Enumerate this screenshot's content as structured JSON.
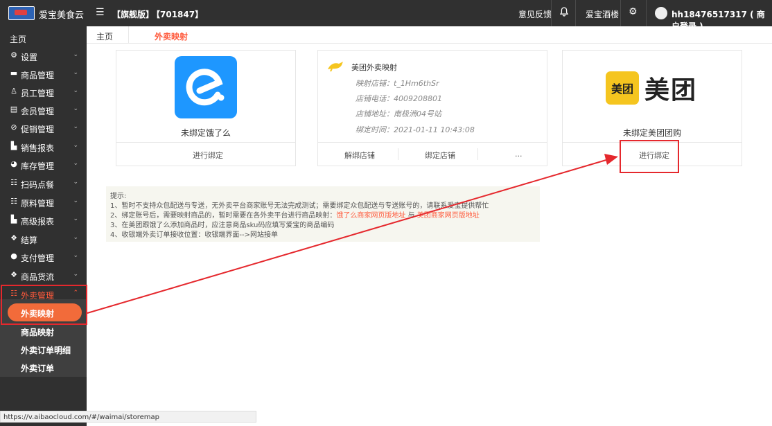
{
  "topbar": {
    "brand": "爱宝美食云",
    "menu_icon": "menu-icon",
    "edition": "【旗舰版】",
    "shop_id": "【701847】",
    "feedback": "意见反馈",
    "bell_icon": "bell-icon",
    "shop_name": "爱宝酒楼",
    "settings_icon": "gear-icon",
    "user": "hh18476517317 ( 商户登录 )"
  },
  "sidebar": {
    "home": "主页",
    "items": [
      {
        "label": "设置",
        "icon": "gear-icon"
      },
      {
        "label": "商品管理",
        "icon": "product-icon"
      },
      {
        "label": "员工管理",
        "icon": "staff-icon"
      },
      {
        "label": "会员管理",
        "icon": "member-icon"
      },
      {
        "label": "促销管理",
        "icon": "promo-icon"
      },
      {
        "label": "销售报表",
        "icon": "chart-icon"
      },
      {
        "label": "库存管理",
        "icon": "stock-icon"
      },
      {
        "label": "扫码点餐",
        "icon": "scan-icon"
      },
      {
        "label": "原料管理",
        "icon": "material-icon"
      },
      {
        "label": "高级报表",
        "icon": "report-icon"
      },
      {
        "label": "结算",
        "icon": "settle-icon"
      },
      {
        "label": "支付管理",
        "icon": "pay-icon"
      },
      {
        "label": "商品货流",
        "icon": "flow-icon"
      },
      {
        "label": "外卖管理",
        "icon": "takeout-icon"
      }
    ],
    "subitems": [
      "外卖映射",
      "商品映射",
      "外卖订单明细",
      "外卖订单"
    ]
  },
  "breadcrumb": {
    "home": "主页",
    "current": "外卖映射"
  },
  "cards": {
    "eleme": {
      "caption": "未绑定饿了么",
      "bind": "进行绑定"
    },
    "meituan_takeout": {
      "title": "美团外卖映射",
      "shop": "映射店铺：t_1Hm6thSr",
      "phone": "店铺电话：4009208801",
      "address": "店铺地址：南极洲04号站",
      "time": "绑定时间：2021-01-11 10:43:08",
      "unbind": "解绑店铺",
      "bindshop": "绑定店铺",
      "more": "..."
    },
    "meituan_group": {
      "logo_square": "美团",
      "logo_word": "美团",
      "caption": "未绑定美团团购",
      "bind": "进行绑定"
    }
  },
  "tips": {
    "title": "提示:",
    "line1": "1、暂时不支持众包配送与专送，无外卖平台商家账号无法完成测试；需要绑定众包配送与专送账号的，请联系爱宝提供帮忙",
    "line2_a": "2、绑定账号后，需要映射商品的，暂时需要在各外卖平台进行商品映射：",
    "line2_link1": "饿了么商家网页版地址",
    "line2_and": " 与 ",
    "line2_link2": "美团商家网页版地址",
    "line3": "3、在美团跟饿了么添加商品时，应注意商品sku码应填写爱宝的商品编码",
    "line4": "4、收银端外卖订单接收位置：收银端界面-->网站接单"
  },
  "status_url": "https://v.aibaocloud.com/#/waimai/storemap",
  "colors": {
    "accent": "#ff5a3c",
    "sidebar": "#303030",
    "annotation": "#e5282d",
    "eleme": "#1e97ff",
    "meituan": "#f5c51f"
  }
}
